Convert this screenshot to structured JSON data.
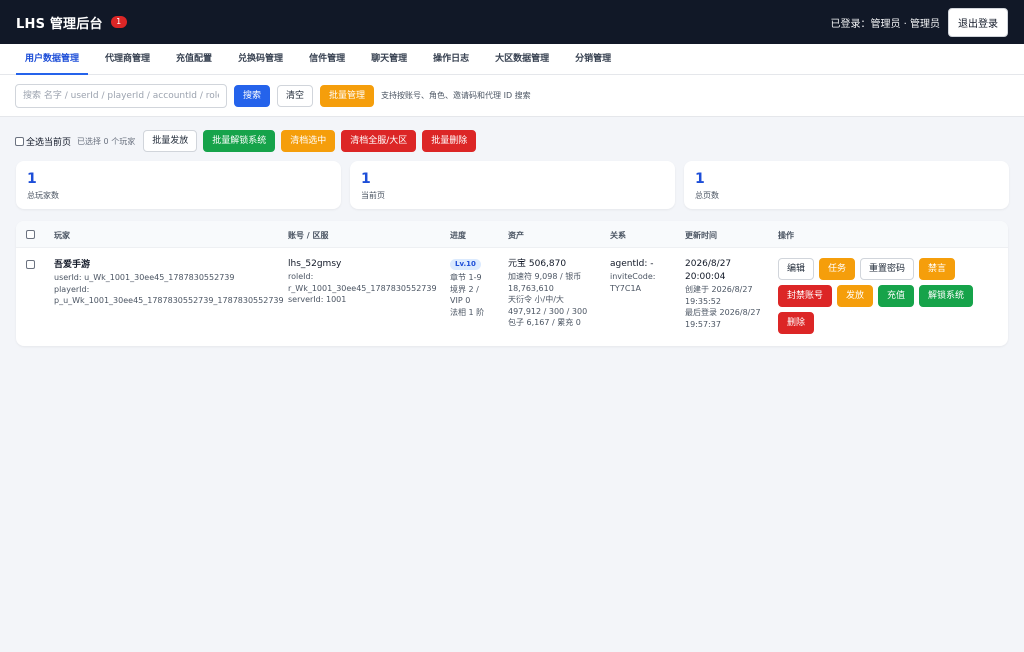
{
  "header": {
    "title": "LHS 管理后台",
    "badge": "1",
    "login_info": "已登录：管理员 · 管理员",
    "logout_label": "退出登录"
  },
  "tabs": [
    {
      "label": "用户数据管理",
      "active": true
    },
    {
      "label": "代理商管理",
      "active": false
    },
    {
      "label": "充值配置",
      "active": false
    },
    {
      "label": "兑换码管理",
      "active": false
    },
    {
      "label": "信件管理",
      "active": false
    },
    {
      "label": "聊天管理",
      "active": false
    },
    {
      "label": "操作日志",
      "active": false
    },
    {
      "label": "大区数据管理",
      "active": false
    },
    {
      "label": "分销管理",
      "active": false
    }
  ],
  "search": {
    "placeholder": "搜索 名字 / userId / playerId / accountId / roleId",
    "value": "",
    "search_label": "搜索",
    "clear_label": "清空",
    "batch_label": "批量管理",
    "hint": "支持按账号、角色、邀请码和代理 ID 搜索"
  },
  "actions": {
    "select_all_label": "全选当前页",
    "selected_count": "已选择 0 个玩家",
    "batch_send": "批量发放",
    "batch_unlock": "批量解锁系统",
    "clear_selected": "清档选中",
    "clear_all": "清档全服/大区",
    "batch_delete": "批量删除"
  },
  "stats": [
    {
      "value": "1",
      "label": "总玩家数"
    },
    {
      "value": "1",
      "label": "当前页"
    },
    {
      "value": "1",
      "label": "总页数"
    }
  ],
  "table": {
    "columns": [
      "玩家",
      "账号 / 区服",
      "进度",
      "资产",
      "关系",
      "更新时间",
      "操作"
    ],
    "row": {
      "name": "吾爱手游",
      "user_id": "userId: u_Wk_1001_30ee45_1787830552739",
      "player_id_label": "playerId:",
      "player_id": "p_u_Wk_1001_30ee45_1787830552739_1787830552739",
      "account": "lhs_52gmsy",
      "role_id_label": "roleId:",
      "role_id": "r_Wk_1001_30ee45_1787830552739",
      "server_id": "serverId: 1001",
      "level": "Lv.10",
      "chapter": "章节 1-9",
      "realm": "境界 2 /",
      "vip": "VIP 0",
      "faxiang": "法相 1 阶",
      "yuanbao": "元宝 506,870",
      "speedup": "加速符 9,098 / 银币",
      "silver": "18,763,610",
      "tianyan": "天衍令 小/中/大",
      "tianyan_vals": "497,912 / 300 / 300",
      "bag": "包子 6,167 / 累充 0",
      "agent": "agentId: -",
      "invite_label": "inviteCode:",
      "invite": "TY7C1A",
      "updated_date": "2026/8/27",
      "updated_time": "20:00:04",
      "created_label": "创建于 2026/8/27",
      "created_time": "19:35:52",
      "lastlogin_label": "最后登录 2026/8/27",
      "lastlogin_time": "19:57:37"
    },
    "ops": [
      {
        "label": "编辑",
        "style": "white"
      },
      {
        "label": "任务",
        "style": "orange"
      },
      {
        "label": "重置密码",
        "style": "white"
      },
      {
        "label": "禁言",
        "style": "orange"
      },
      {
        "label": "封禁账号",
        "style": "red"
      },
      {
        "label": "发放",
        "style": "orange"
      },
      {
        "label": "充值",
        "style": "green"
      },
      {
        "label": "解锁系统",
        "style": "green"
      },
      {
        "label": "删除",
        "style": "red"
      }
    ]
  }
}
